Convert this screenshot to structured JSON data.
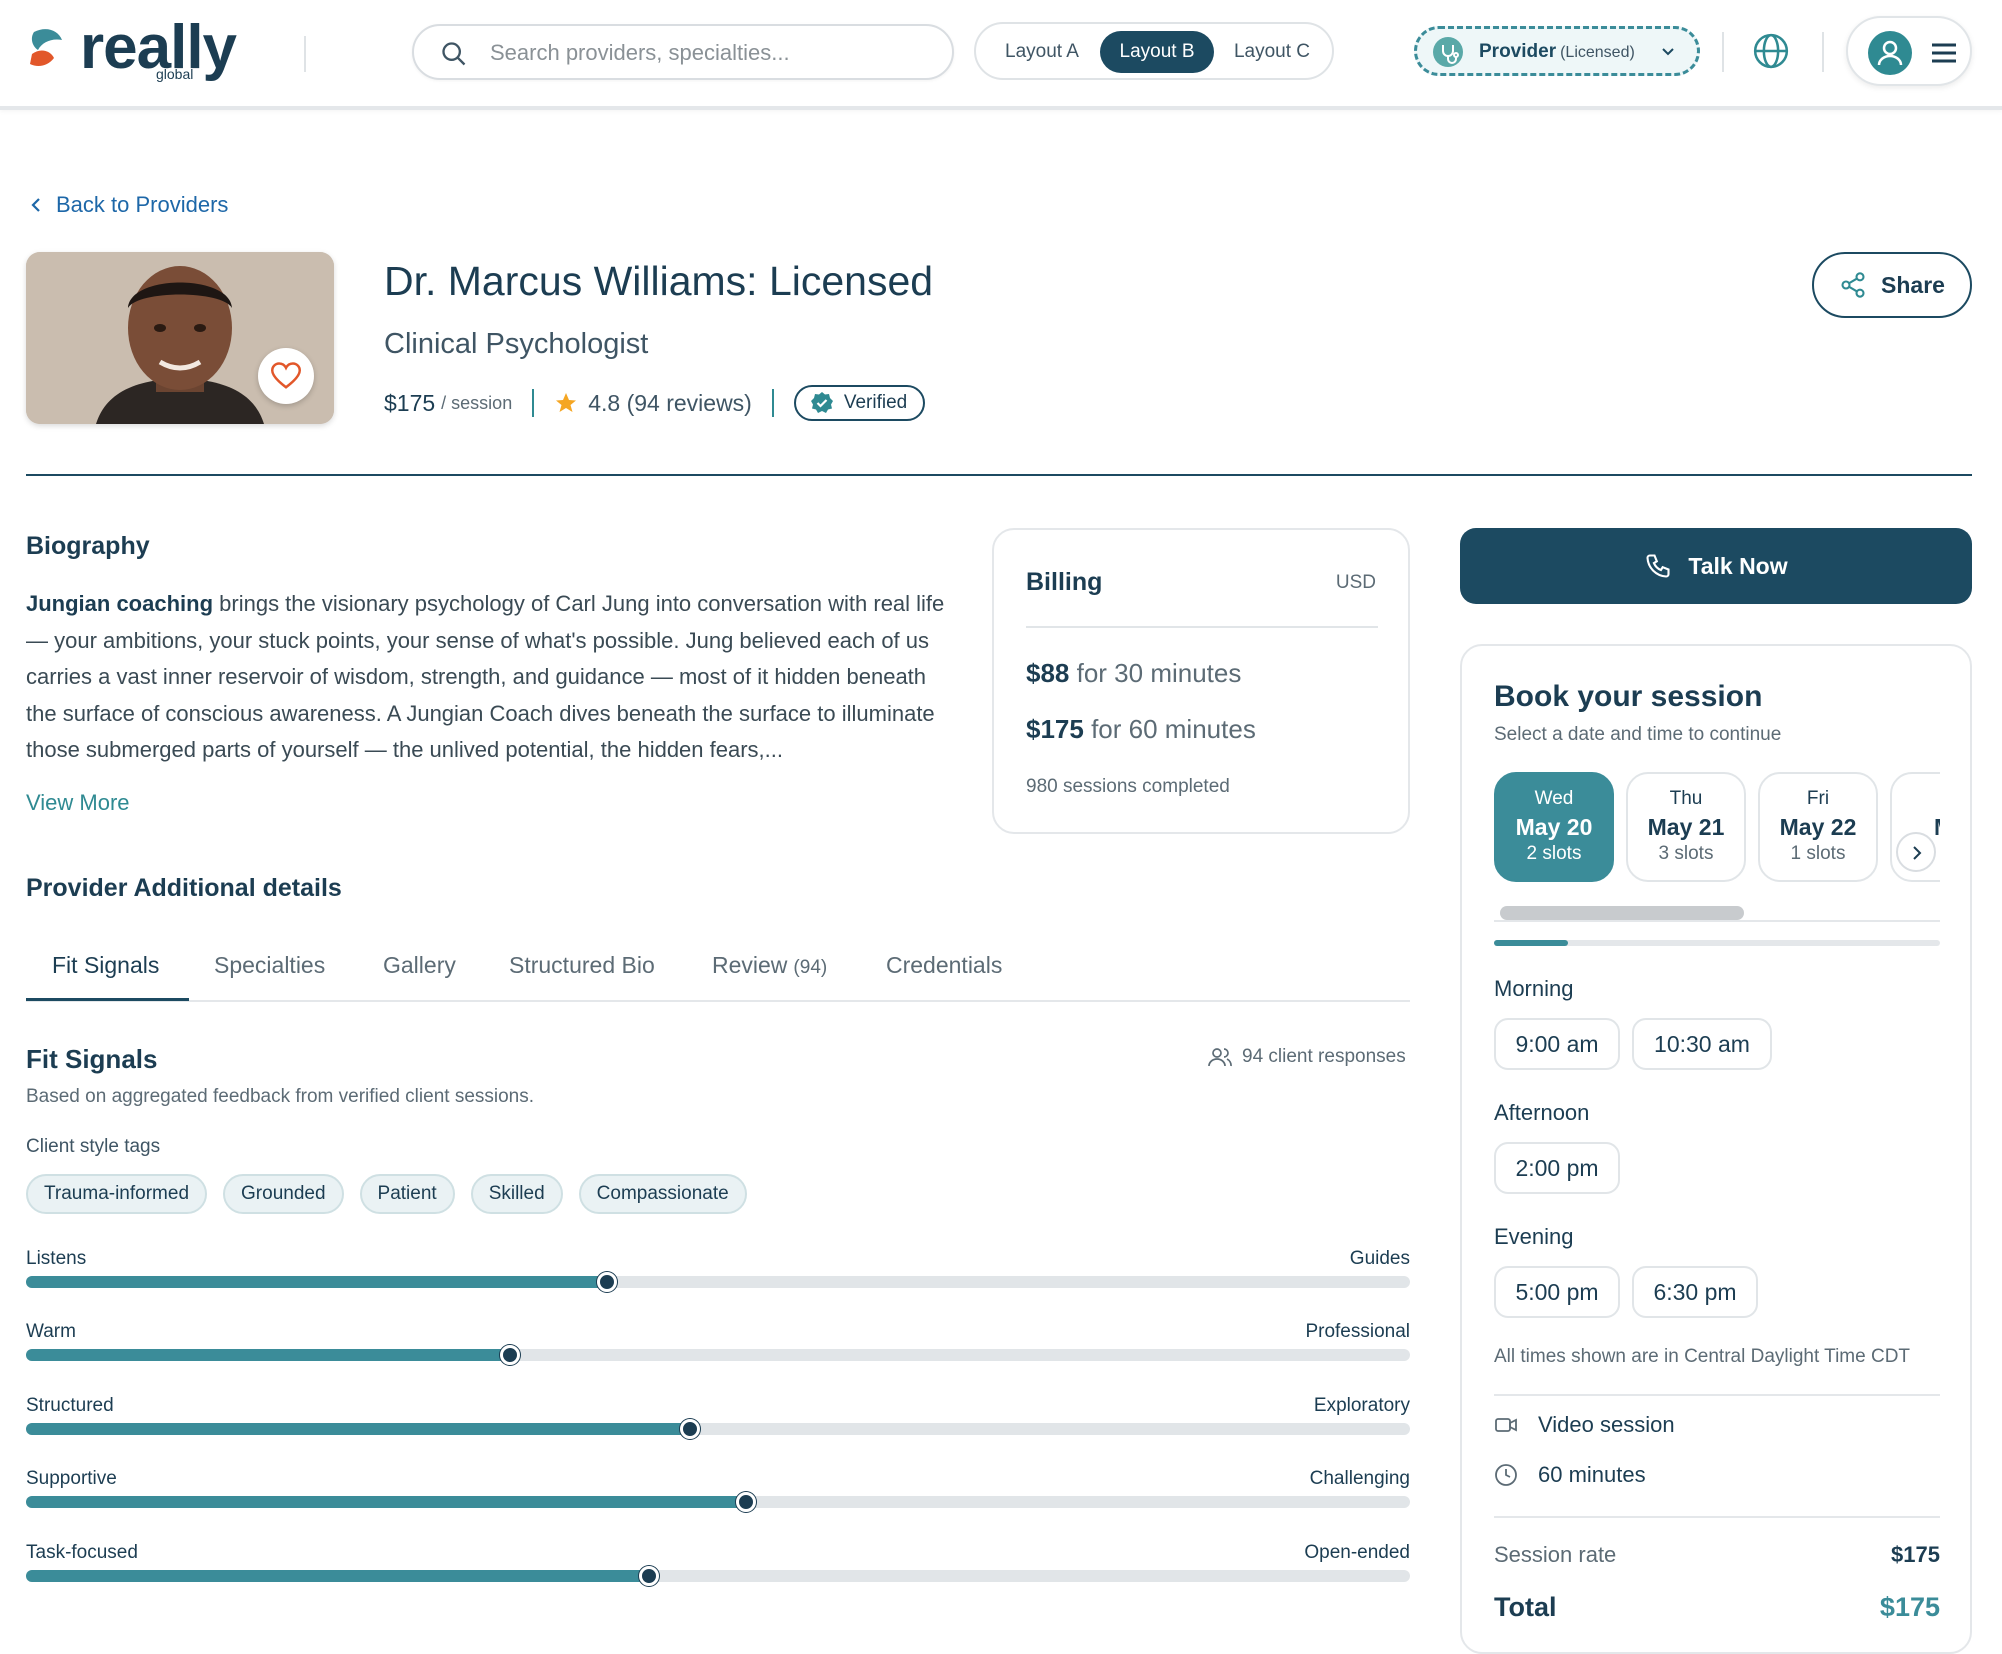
{
  "brand": {
    "name": "really",
    "sub": "global",
    "colors": {
      "primary": "#1c4a61",
      "accent": "#3b8c99",
      "link": "#1d67a8",
      "star": "#f5a623",
      "heart": "#e2572a"
    }
  },
  "header": {
    "search_placeholder": "Search providers, specialties...",
    "layouts": [
      "Layout A",
      "Layout B",
      "Layout C"
    ],
    "active_layout": "Layout B",
    "role_label": "Provider",
    "role_sub": "(Licensed)",
    "icons": [
      "search-icon",
      "stethoscope-icon",
      "chevron-down-icon",
      "globe-icon",
      "user-icon",
      "menu-icon"
    ]
  },
  "nav": {
    "back_label": "Back to Providers"
  },
  "provider": {
    "name": "Dr. Marcus Williams: Licensed",
    "title": "Clinical Psychologist",
    "price": "$175",
    "price_unit": "/ session",
    "rating": "4.8 (94 reviews)",
    "verified": "Verified",
    "share": "Share"
  },
  "bio": {
    "heading": "Biography",
    "lead": "Jungian coaching",
    "text": " brings the visionary psychology of Carl Jung into conversation with real life — your ambitions, your stuck points, your sense of what's possible. Jung believed each of us carries a vast inner reservoir of wisdom, strength, and guidance — most of it hidden beneath the surface of conscious awareness. A Jungian Coach dives beneath the surface to illuminate those submerged parts of yourself — the unlived potential, the hidden fears,...",
    "view_more": "View More"
  },
  "billing": {
    "heading": "Billing",
    "currency": "USD",
    "rates": [
      {
        "amount": "$88",
        "label": " for 30 minutes"
      },
      {
        "amount": "$175",
        "label": " for 60 minutes"
      }
    ],
    "sessions_completed": "980 sessions completed"
  },
  "details": {
    "heading": "Provider Additional details",
    "tabs": [
      "Fit Signals",
      "Specialties",
      "Gallery",
      "Structured Bio",
      "Review",
      "Credentials"
    ],
    "review_count": "(94)",
    "active_tab": "Fit Signals"
  },
  "fit_signals": {
    "heading": "Fit Signals",
    "responses": "94 client responses",
    "subtitle": "Based on aggregated feedback from verified client sessions.",
    "tags_heading": "Client style tags",
    "tags": [
      "Trauma-informed",
      "Grounded",
      "Patient",
      "Skilled",
      "Compassionate"
    ],
    "scales": [
      {
        "left": "Listens",
        "right": "Guides",
        "value": 0.42
      },
      {
        "left": "Warm",
        "right": "Professional",
        "value": 0.35
      },
      {
        "left": "Structured",
        "right": "Exploratory",
        "value": 0.48
      },
      {
        "left": "Supportive",
        "right": "Challenging",
        "value": 0.52
      },
      {
        "left": "Task-focused",
        "right": "Open-ended",
        "value": 0.45
      }
    ]
  },
  "booking": {
    "talk_now": "Talk Now",
    "heading": "Book your session",
    "subheading": "Select a date and time to continue",
    "days": [
      {
        "weekday": "Wed",
        "date": "May 20",
        "slots": "2 slots"
      },
      {
        "weekday": "Thu",
        "date": "May 21",
        "slots": "3 slots"
      },
      {
        "weekday": "Fri",
        "date": "May 22",
        "slots": "1 slots"
      },
      {
        "weekday": "M",
        "date": "Ma",
        "slots": ""
      }
    ],
    "active_day": 0,
    "periods": [
      {
        "label": "Morning",
        "times": [
          "9:00 am",
          "10:30 am"
        ]
      },
      {
        "label": "Afternoon",
        "times": [
          "2:00 pm"
        ]
      },
      {
        "label": "Evening",
        "times": [
          "5:00 pm",
          "6:30 pm"
        ]
      }
    ],
    "timezone_note": "All times shown are in Central Daylight Time CDT",
    "session_type": "Video session",
    "duration": "60 minutes",
    "session_rate_label": "Session rate",
    "session_rate": "$175",
    "total_label": "Total",
    "total": "$175"
  }
}
